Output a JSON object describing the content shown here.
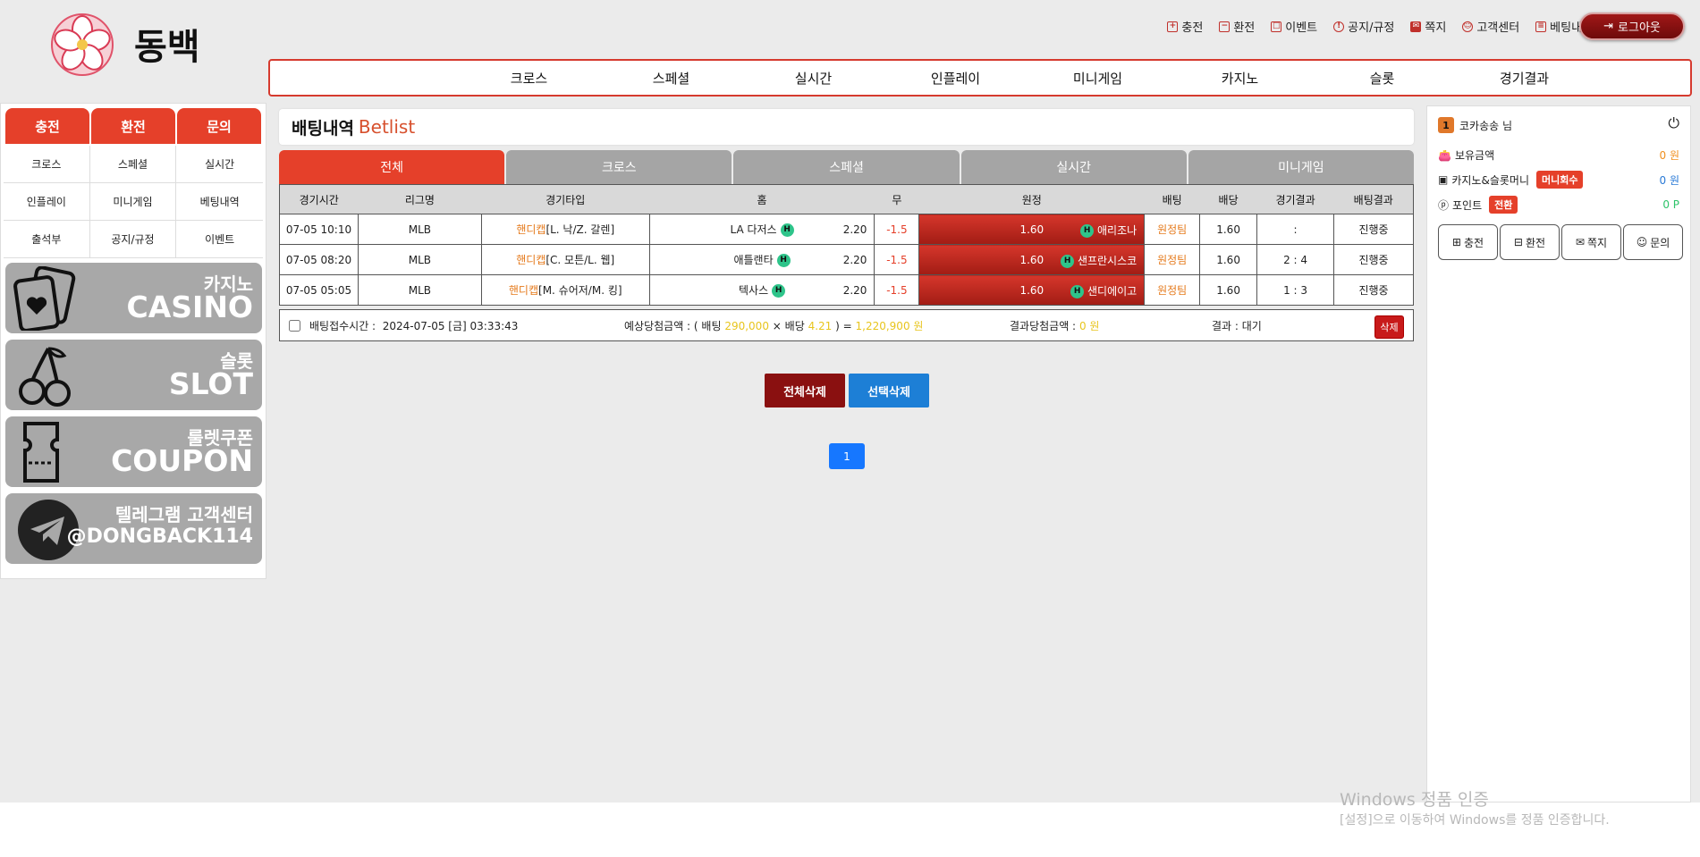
{
  "brand": {
    "logo_text": "동백"
  },
  "topnav": [
    {
      "label": "충전",
      "icon": "plus-square-icon"
    },
    {
      "label": "환전",
      "icon": "minus-square-icon"
    },
    {
      "label": "이벤트",
      "icon": "gift-icon"
    },
    {
      "label": "공지/규정",
      "icon": "alert-circle-icon"
    },
    {
      "label": "쪽지",
      "icon": "envelope-icon"
    },
    {
      "label": "고객센터",
      "icon": "headset-icon"
    },
    {
      "label": "베팅내역",
      "icon": "list-icon"
    }
  ],
  "logout_label": "로그아웃",
  "mainnav": [
    "크로스",
    "스페셜",
    "실시간",
    "인플레이",
    "미니게임",
    "카지노",
    "슬롯",
    "경기결과"
  ],
  "left": {
    "top_buttons": [
      "충전",
      "환전",
      "문의"
    ],
    "grid": [
      "크로스",
      "스페셜",
      "실시간",
      "인플레이",
      "미니게임",
      "베팅내역",
      "출석부",
      "공지/규정",
      "이벤트"
    ],
    "banners": [
      {
        "ko": "카지노",
        "en": "CASINO"
      },
      {
        "ko": "슬롯",
        "en": "SLOT"
      },
      {
        "ko": "룰렛쿠폰",
        "en": "COUPON"
      },
      {
        "ko": "텔레그램 고객센터",
        "en": "@DONGBACK114"
      }
    ]
  },
  "center": {
    "title_ko": "배팅내역",
    "title_en": "Betlist",
    "tabs": [
      "전체",
      "크로스",
      "스페셜",
      "실시간",
      "미니게임"
    ],
    "columns": [
      "경기시간",
      "리그명",
      "경기타입",
      "홈",
      "무",
      "원정",
      "배팅",
      "배당",
      "경기결과",
      "배팅결과"
    ],
    "rows": [
      {
        "time": "07-05 10:10",
        "league": "MLB",
        "type_hl": "핸디캡",
        "type": "[L. 낙/Z. 갈렌]",
        "home": "LA 다저스",
        "home_odd": "2.20",
        "draw": "-1.5",
        "away_odd": "1.60",
        "away": "애리조나",
        "pick": "원정팀",
        "odds": "1.60",
        "score": ":",
        "result": "진행중"
      },
      {
        "time": "07-05 08:20",
        "league": "MLB",
        "type_hl": "핸디캡",
        "type": "[C. 모튼/L. 웹]",
        "home": "애틀랜타",
        "home_odd": "2.20",
        "draw": "-1.5",
        "away_odd": "1.60",
        "away": "샌프란시스코",
        "pick": "원정팀",
        "odds": "1.60",
        "score": "2 : 4",
        "result": "진행중"
      },
      {
        "time": "07-05 05:05",
        "league": "MLB",
        "type_hl": "핸디캡",
        "type": "[M. 슈어저/M. 킹]",
        "home": "텍사스",
        "home_odd": "2.20",
        "draw": "-1.5",
        "away_odd": "1.60",
        "away": "샌디에이고",
        "pick": "원정팀",
        "odds": "1.60",
        "score": "1 : 3",
        "result": "진행중"
      }
    ],
    "h_badge": "H",
    "summary": {
      "time_label": "배팅접수시간 :",
      "time_value": "2024-07-05 [금] 03:33:43",
      "expected_prefix": "예상당첨금액 : ( 배팅",
      "bet_amount": "290,000",
      "times": "× 배당",
      "total_odds": "4.21",
      "equals": ") =",
      "expected_amount": "1,220,900 원",
      "win_label": "결과당첨금액 :",
      "win_value": "0 원",
      "result_label": "결과 : 대기",
      "delete_label": "삭제"
    },
    "delete_all": "전체삭제",
    "delete_selected": "선택삭제",
    "page": "1"
  },
  "right": {
    "level": "1",
    "user": "코카송송 님",
    "balance_label": "보유금액",
    "balance_value": "0 원",
    "casino_label": "카지노&슬롯머니",
    "casino_badge": "머니회수",
    "casino_value": "0 원",
    "point_label": "포인트",
    "point_badge": "전환",
    "point_value": "0 P",
    "buttons": [
      "충전",
      "환전",
      "쪽지",
      "문의"
    ]
  },
  "watermark": {
    "line1": "Windows 정품 인증",
    "line2": "[설정]으로 이동하여 Windows를 정품 인증합니다."
  },
  "colors": {
    "accent": "#e5402a",
    "brand_dark": "#8a1010",
    "blue": "#1677ff"
  }
}
